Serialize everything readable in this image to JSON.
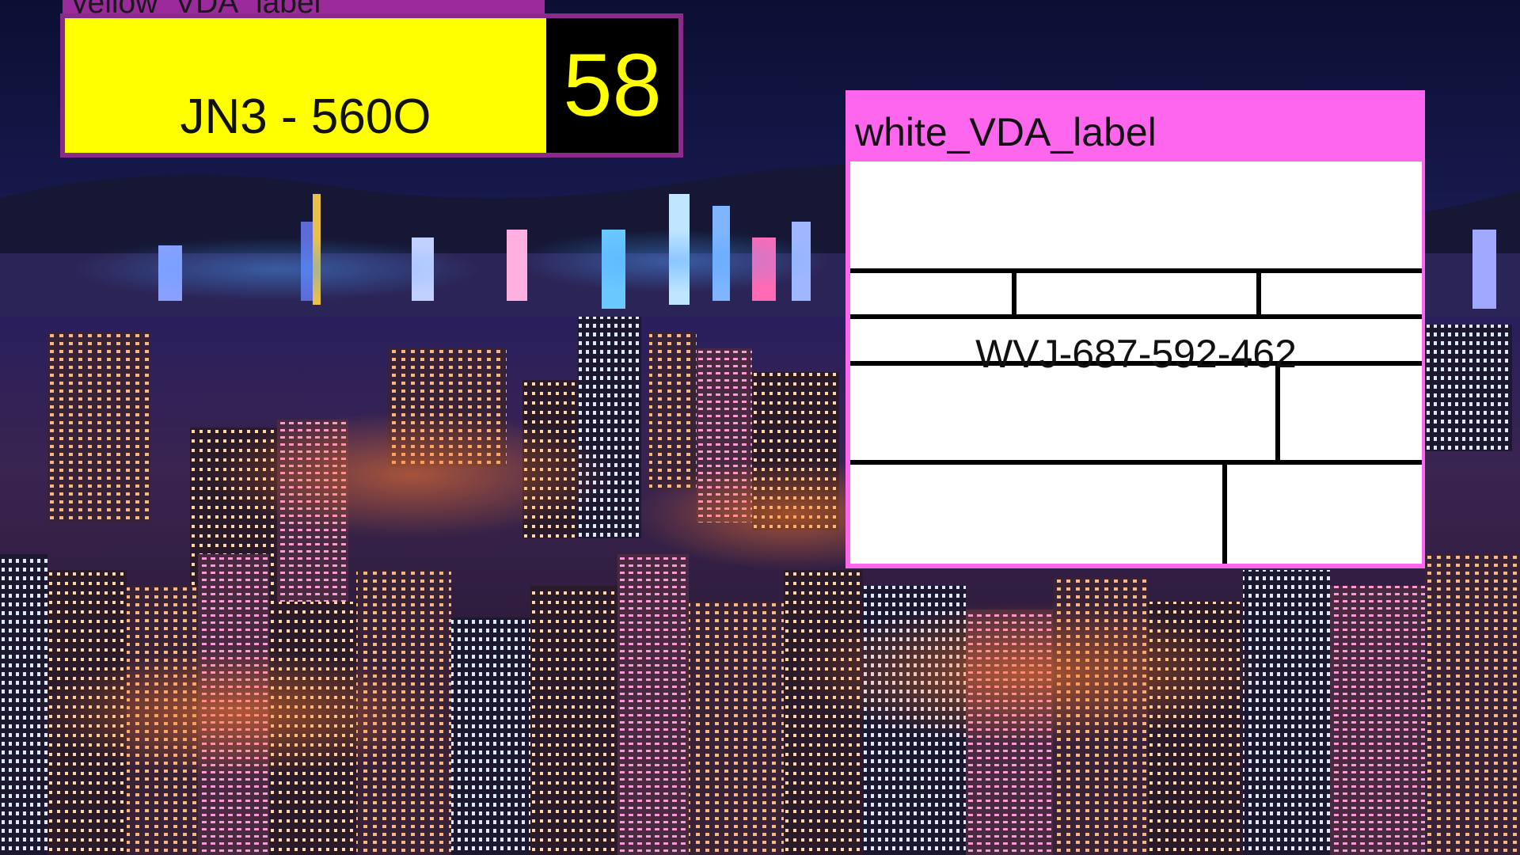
{
  "background": {
    "description_icon": "night-city-skyline-image",
    "sky_color": "#0a0d2a"
  },
  "yellow_label": {
    "tag": "yellow_VDA_label",
    "code": "JN3 - 560O",
    "number": "58",
    "colors": {
      "fill": "#ffff00",
      "border": "#8a2b8c",
      "tag_bg": "#9b2a9a",
      "number_bg": "#000000"
    }
  },
  "white_label": {
    "title": "white_VDA_label",
    "code": "WVJ-687-592-462",
    "colors": {
      "frame": "#ff66ee",
      "fill": "#ffffff",
      "grid": "#000000"
    }
  }
}
